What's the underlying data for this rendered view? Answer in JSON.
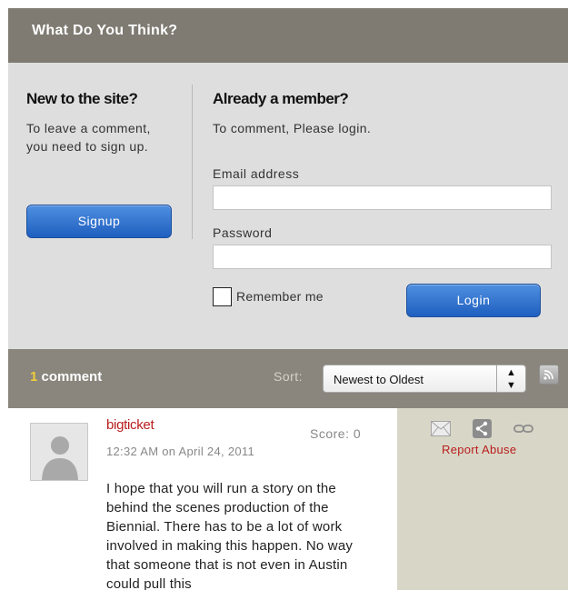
{
  "header": {
    "title": "What Do You Think?"
  },
  "new_user": {
    "title": "New to the site?",
    "text": "To leave a comment, you need to sign up.",
    "signup_label": "Signup"
  },
  "member": {
    "title": "Already a member?",
    "text": "To comment, Please login.",
    "email_label": "Email address",
    "email_value": "",
    "password_label": "Password",
    "password_value": "",
    "remember_label": "Remember me",
    "login_label": "Login"
  },
  "comments_bar": {
    "count": "1",
    "count_label": "comment",
    "sort_label": "Sort:",
    "sort_value": "Newest to Oldest"
  },
  "comments": [
    {
      "username": "bigticket",
      "score": "Score: 0",
      "time": "12:32 AM",
      "date_prefix": "on",
      "date": "April 24, 2011",
      "body": "I hope that you will run a story on the behind the scenes production of the Biennial. There has to be a lot of work involved in making this happen. No way that someone that is not even in Austin could pull this"
    }
  ],
  "actions": {
    "report_label": "Report Abuse"
  },
  "icons": {
    "avatar": "person-silhouette-icon",
    "sort": "sort-arrows-icon",
    "rss": "rss-icon",
    "mail": "mail-icon",
    "share": "share-icon",
    "link": "link-icon"
  },
  "colors": {
    "header_bg": "#7f7b72",
    "bar_bg": "#8a867d",
    "panel_bg": "#dedede",
    "button_blue": "#2e6fd0",
    "accent_red": "#b91d1d",
    "count_yellow": "#f0cd3a",
    "actions_bg": "#d8d7c7"
  }
}
